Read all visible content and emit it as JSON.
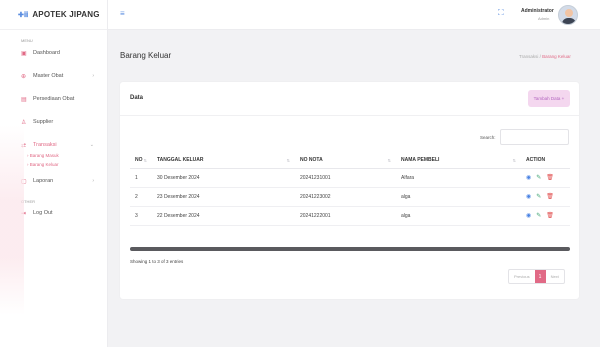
{
  "brand": {
    "logo": "✚ⅲ",
    "name": "APOTEK JIPANG"
  },
  "sidebar": {
    "menu_label": "MENU",
    "other_label": "OTHER",
    "items": [
      {
        "label": "Dashboard",
        "icon": "dashboard-icon"
      },
      {
        "label": "Master Obat",
        "icon": "master-icon"
      },
      {
        "label": "Persediaan Obat",
        "icon": "stock-icon"
      },
      {
        "label": "Supplier",
        "icon": "user-icon"
      },
      {
        "label": "Transaksi",
        "icon": "transaction-icon"
      },
      {
        "label": "Laporan",
        "icon": "report-icon"
      },
      {
        "label": "Log Out",
        "icon": "logout-icon"
      }
    ],
    "sub_items": [
      {
        "label": "› Barang Masuk"
      },
      {
        "label": "› Barang Keluar"
      }
    ]
  },
  "topbar": {
    "user_name": "Administrator",
    "user_role": "Admin"
  },
  "page": {
    "title": "Barang Keluar",
    "breadcrumb": {
      "parent": "Transaksi",
      "separator": "/",
      "current": "Barang Keluar"
    }
  },
  "card": {
    "title": "Data",
    "add_button": "Tambah Data +"
  },
  "search": {
    "label": "Search:",
    "value": ""
  },
  "table": {
    "headers": [
      "NO",
      "TANGGAL KELUAR",
      "NO NOTA",
      "NAMA PEMBELI",
      "ACTION"
    ],
    "rows": [
      {
        "no": "1",
        "tanggal": "30 Desember 2024",
        "nota": "20241231001",
        "pembeli": "Alfara"
      },
      {
        "no": "2",
        "tanggal": "23 Desember 2024",
        "nota": "20241223002",
        "pembeli": "alga"
      },
      {
        "no": "3",
        "tanggal": "22 Desember 2024",
        "nota": "20241222001",
        "pembeli": "alga"
      }
    ]
  },
  "footer": {
    "entries_info": "Showing 1 to 3 of 3 entries",
    "previous": "Previous",
    "page": "1",
    "next": "Next"
  },
  "colors": {
    "accent": "#e16a86",
    "brand_blue": "#5a8de0",
    "button_bg": "#f4d7ef"
  }
}
